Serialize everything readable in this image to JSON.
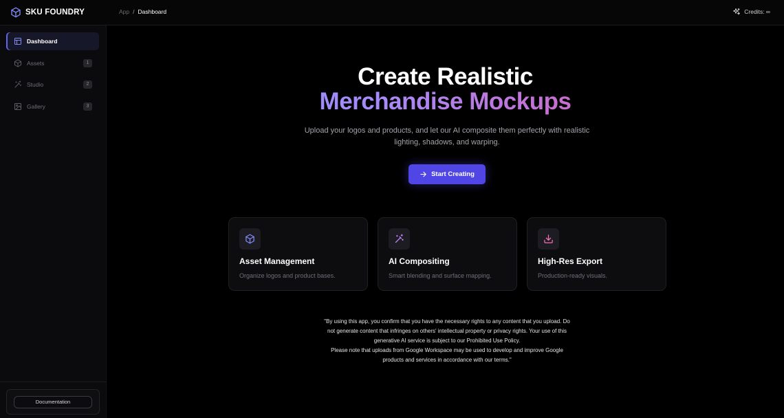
{
  "brand": {
    "name": "SKU FOUNDRY",
    "icon": "cube-icon",
    "accent": "#6366f1"
  },
  "breadcrumb": {
    "root": "App",
    "separator": "/",
    "current": "Dashboard"
  },
  "credits": {
    "label": "Credits: ∞",
    "icon": "sparkles-icon"
  },
  "sidebar": {
    "items": [
      {
        "label": "Dashboard",
        "icon": "layout-icon",
        "active": true
      },
      {
        "label": "Assets",
        "icon": "box-icon",
        "badge": "1"
      },
      {
        "label": "Studio",
        "icon": "magic-wand-icon",
        "badge": "2"
      },
      {
        "label": "Gallery",
        "icon": "image-icon",
        "badge": "3"
      }
    ],
    "footer": {
      "documentation_label": "Documentation"
    }
  },
  "hero": {
    "title_line1": "Create Realistic",
    "title_line2": "Merchandise Mockups",
    "subtitle": "Upload your logos and products, and let our AI composite them perfectly with realistic lighting, shadows, and warping.",
    "cta_label": "Start Creating",
    "cta_icon": "arrow-right-icon",
    "gradient": [
      "#818cf8",
      "#a78bfa",
      "#d066c4",
      "#ec4899"
    ]
  },
  "features": [
    {
      "title": "Asset Management",
      "description": "Organize logos and product bases.",
      "icon": "box-icon",
      "icon_color": "#818cf8"
    },
    {
      "title": "AI Compositing",
      "description": "Smart blending and surface mapping.",
      "icon": "magic-wand-icon",
      "icon_color": "#c084fc"
    },
    {
      "title": "High-Res Export",
      "description": "Production-ready visuals.",
      "icon": "download-icon",
      "icon_color": "#f472b6"
    }
  ],
  "disclaimer": {
    "lines": [
      "\"By using this app, you confirm that you have the necessary rights to any content that you upload. Do",
      "not generate content that infringes on others' intellectual property or privacy rights. Your use of this",
      "generative AI service is subject to our Prohibited Use Policy.",
      "Please note that uploads from Google Workspace may be used to develop and improve Google",
      "products and services in accordance with our terms.\""
    ]
  }
}
